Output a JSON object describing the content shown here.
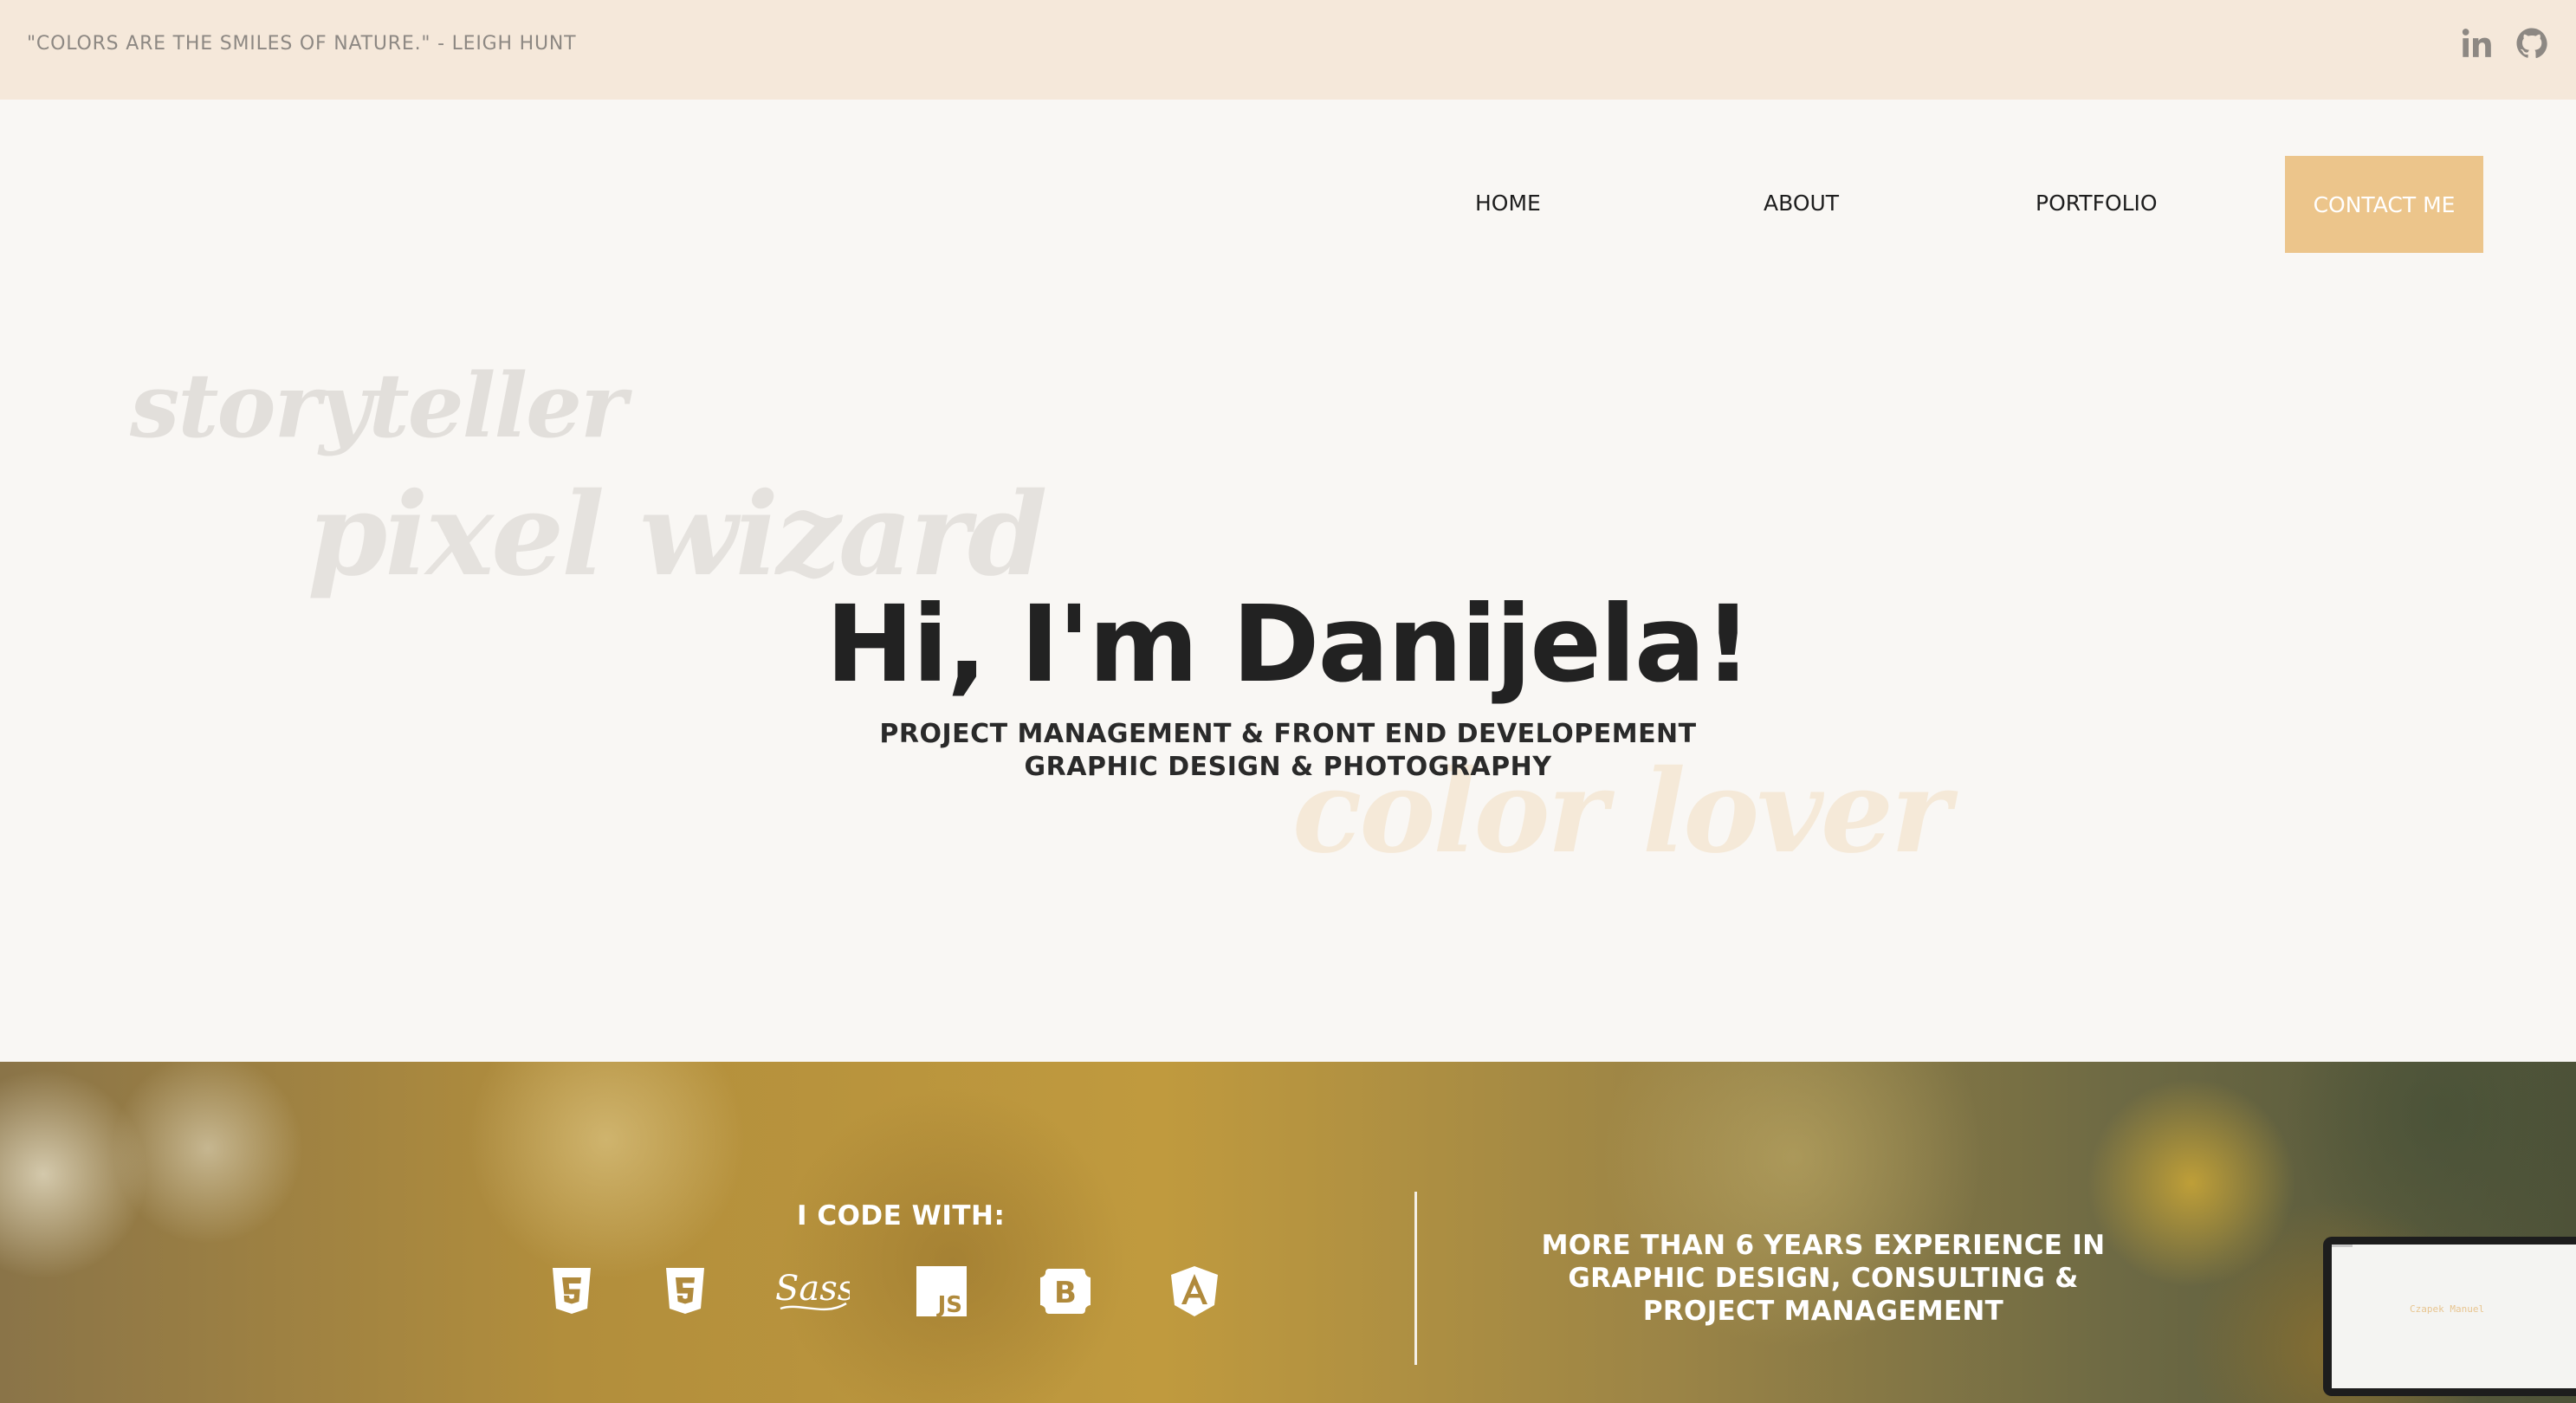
{
  "topbar": {
    "quote": "\"COLORS ARE THE SMILES OF NATURE.\" - LEIGH HUNT",
    "social_icons": [
      "linkedin-icon",
      "github-icon"
    ]
  },
  "nav": {
    "items": [
      "HOME",
      "ABOUT",
      "PORTFOLIO"
    ],
    "cta": "CONTACT ME"
  },
  "hero": {
    "background_words": [
      "storyteller",
      "pixel wizard",
      "color lover"
    ],
    "title": "Hi, I'm Danijela!",
    "subtitle_lines": [
      "PROJECT MANAGEMENT & FRONT END DEVELOPEMENT",
      "GRAPHIC DESIGN & PHOTOGRAPHY"
    ]
  },
  "skills": {
    "title": "I CODE WITH:",
    "icons": [
      "html5-icon",
      "css3-icon",
      "sass-icon",
      "javascript-icon",
      "bootstrap-icon",
      "angular-icon"
    ],
    "experience_lines": [
      "MORE THAN 6 YEARS EXPERIENCE IN",
      "GRAPHIC DESIGN, CONSULTING &",
      "PROJECT MANAGEMENT"
    ]
  },
  "laptop_preview": {
    "brand": "Czapek Manuel"
  },
  "colors": {
    "topbar_bg": "#f5e8da",
    "page_bg": "#f9f7f4",
    "accent": "#ecc58b",
    "text_dark": "#222222"
  }
}
